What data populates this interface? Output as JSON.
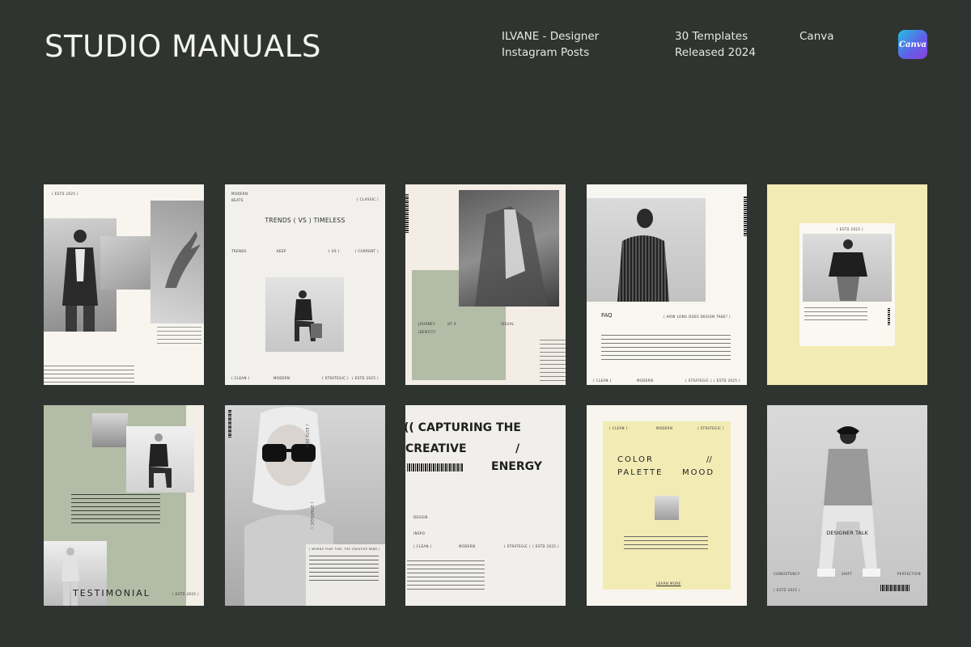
{
  "header": {
    "brand": "STUDIO MANUALS",
    "product_line1": "ILVANE - Designer",
    "product_line2": "Instagram Posts",
    "count_line1": "30 Templates",
    "count_line2": "Released 2024",
    "platform": "Canva",
    "logo_text": "Canva"
  },
  "cards": {
    "c1": {
      "tag": "( ESTD 2025 )"
    },
    "c2": {
      "top_left1": "MODERN",
      "top_left2": "BEATS",
      "top_right": "( CLASSIC )",
      "title": "TRENDS ( VS ) TIMELESS",
      "row_a": "TRENDS",
      "row_b": "KEEP",
      "row_c": "( US )",
      "row_d": "( CURRENT )",
      "foot_a": "( CLEAN )",
      "foot_b": "MODERN",
      "foot_c": "( STRATEGIC )",
      "foot_d": "( ESTD 2025 )"
    },
    "c3": {
      "label_a": "JOURNEY",
      "label_b": "OF A",
      "label_c": "VISUAL",
      "label_d": "IDENTITY"
    },
    "c4": {
      "title": "FAQ",
      "question": "( HOW LONG DOES DESIGN TAKE? )",
      "foot_a": "( CLEAN )",
      "foot_b": "MODERN",
      "foot_c": "( STRATEGIC )",
      "foot_d": "( ESTD 2025 )"
    },
    "c5": {
      "tag": "( ESTD 2025 )"
    },
    "c6": {
      "title": "TESTIMONIAL",
      "tag": "( ESTD 2025 )"
    },
    "c7": {
      "tag": "( ESTD 2025 )",
      "side": "( STRATEGIC )",
      "caption": "( WORDS THAT FUEL THE CREATIVE MIND )"
    },
    "c8": {
      "line1": "(( CAPTURING THE",
      "line2": "CREATIVE",
      "line3": "/",
      "line4": "ENERGY",
      "label_a": "DESIGN",
      "label_b": "INSPO",
      "foot_a": "( CLEAN )",
      "foot_b": "MODERN",
      "foot_c": "( STRATEGIC )",
      "foot_d": "( ESTD 2025 )"
    },
    "c9": {
      "top_a": "( CLEAN )",
      "top_b": "MODERN",
      "top_c": "( STRATEGIC )",
      "line1": "COLOR",
      "slash": "//",
      "line2": "PALETTE",
      "line3": "MOOD",
      "link": "LEARN MORE"
    },
    "c10": {
      "title": "DESIGNER TALK",
      "row_a": "CONSISTENCY",
      "row_b": "SHIFT",
      "row_c": "PERFECTION",
      "tag": "( ESTD 2025 )"
    }
  },
  "colors": {
    "background": "#2f3430",
    "cream": "#f7f5ee",
    "sage": "#b3bca6",
    "butter": "#f2ebb4"
  }
}
